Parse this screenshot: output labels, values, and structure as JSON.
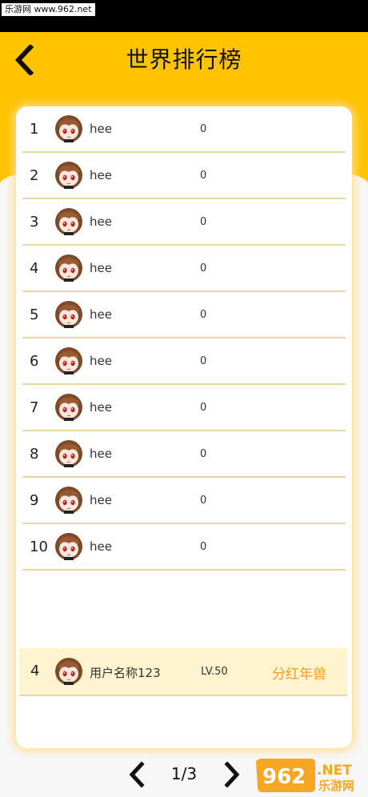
{
  "watermark": "乐游网 www.962.net",
  "header": {
    "title": "世界排行榜"
  },
  "rankings": [
    {
      "rank": "1",
      "name": "hee",
      "score": "0"
    },
    {
      "rank": "2",
      "name": "hee",
      "score": "0"
    },
    {
      "rank": "3",
      "name": "hee",
      "score": "0"
    },
    {
      "rank": "4",
      "name": "hee",
      "score": "0"
    },
    {
      "rank": "5",
      "name": "hee",
      "score": "0"
    },
    {
      "rank": "6",
      "name": "hee",
      "score": "0"
    },
    {
      "rank": "7",
      "name": "hee",
      "score": "0"
    },
    {
      "rank": "8",
      "name": "hee",
      "score": "0"
    },
    {
      "rank": "9",
      "name": "hee",
      "score": "0"
    },
    {
      "rank": "10",
      "name": "hee",
      "score": "0"
    }
  ],
  "self": {
    "rank": "4",
    "name": "用户名称123",
    "level": "LV.50",
    "reward": "分红年兽"
  },
  "pager": {
    "label": "1/3"
  },
  "brand": {
    "logo": "962",
    "suffix": ".NET",
    "site": "乐游网"
  },
  "colors": {
    "header": "#ffc300",
    "reward": "#f39c28",
    "divider": "#ead7a4"
  }
}
